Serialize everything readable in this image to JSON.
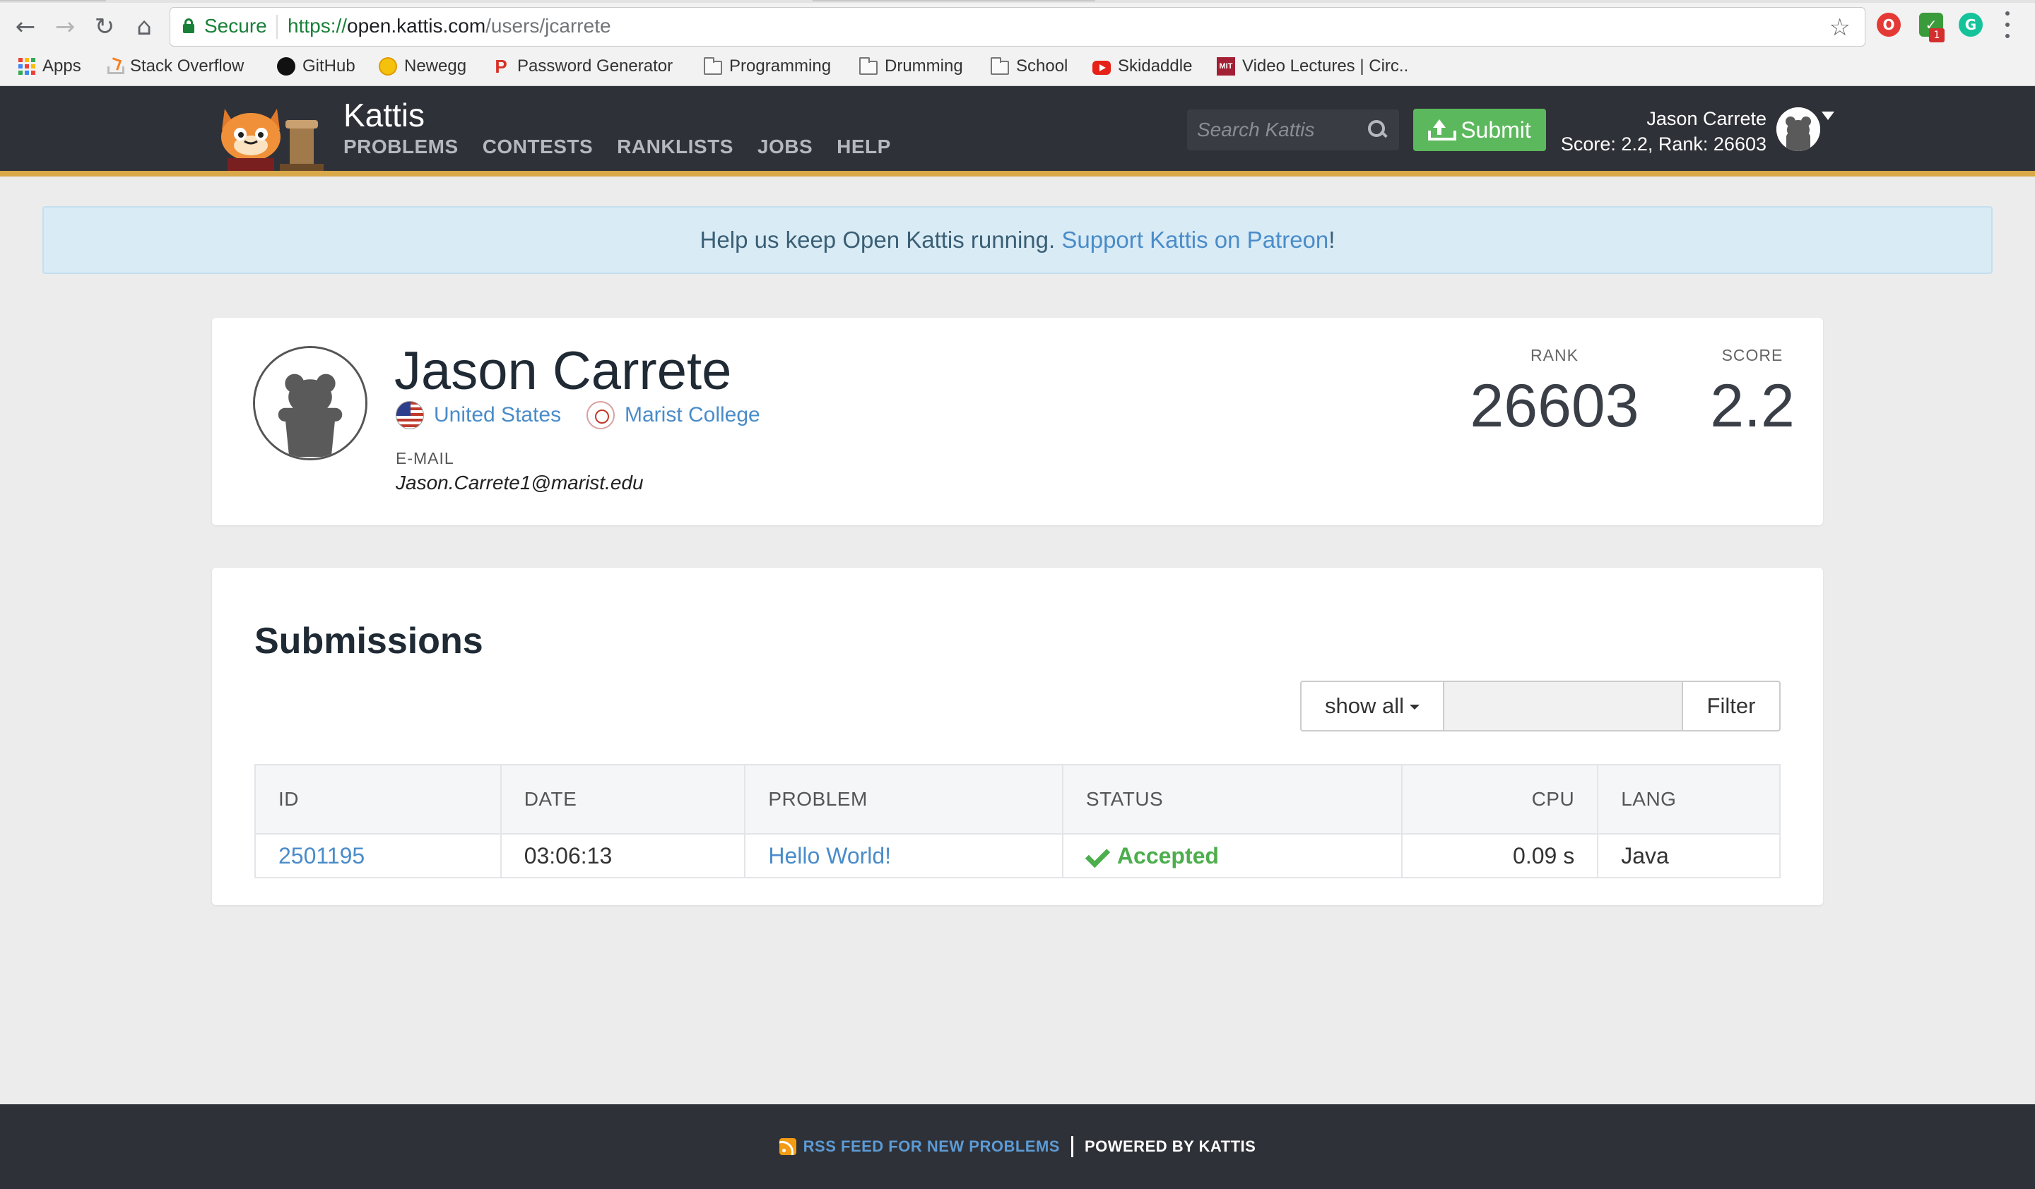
{
  "browser": {
    "secure_label": "Secure",
    "url_protocol": "https://",
    "url_host": "open.kattis.com",
    "url_path": "/users/jcarrete",
    "bookmarks": [
      {
        "label": "Apps",
        "icon": "apps-grid-icon"
      },
      {
        "label": "Stack Overflow",
        "icon": "stackoverflow-icon"
      },
      {
        "label": "GitHub",
        "icon": "github-icon"
      },
      {
        "label": "Newegg",
        "icon": "newegg-icon"
      },
      {
        "label": "Password Generator",
        "icon": "password-generator-icon"
      },
      {
        "label": "Programming",
        "icon": "folder-icon"
      },
      {
        "label": "Drumming",
        "icon": "folder-icon"
      },
      {
        "label": "School",
        "icon": "folder-icon"
      },
      {
        "label": "Skidaddle",
        "icon": "youtube-icon"
      },
      {
        "label": "Video Lectures | Circ..",
        "icon": "mit-ocw-icon"
      }
    ],
    "extension_badge": "1"
  },
  "header": {
    "brand": "Kattis",
    "nav": [
      "PROBLEMS",
      "CONTESTS",
      "RANKLISTS",
      "JOBS",
      "HELP"
    ],
    "search_placeholder": "Search Kattis",
    "submit_label": "Submit",
    "user_name": "Jason Carrete",
    "user_score_rank": "Score: 2.2, Rank: 26603"
  },
  "alert": {
    "text": "Help us keep Open Kattis running. ",
    "link": "Support Kattis on Patreon",
    "suffix": "!"
  },
  "profile": {
    "name": "Jason Carrete",
    "country": "United States",
    "school": "Marist College",
    "email_label": "E-MAIL",
    "email": "Jason.Carrete1@marist.edu",
    "rank_label": "RANK",
    "rank": "26603",
    "score_label": "SCORE",
    "score": "2.2"
  },
  "submissions": {
    "title": "Submissions",
    "filter_select": "show all",
    "filter_value": "",
    "filter_button": "Filter",
    "columns": [
      "ID",
      "DATE",
      "PROBLEM",
      "STATUS",
      "CPU",
      "LANG"
    ],
    "rows": [
      {
        "id": "2501195",
        "date": "03:06:13",
        "problem": "Hello World!",
        "status": "Accepted",
        "cpu": "0.09 s",
        "lang": "Java"
      }
    ]
  },
  "footer": {
    "rss": "RSS FEED FOR NEW PROBLEMS",
    "powered": "POWERED BY KATTIS"
  },
  "colors": {
    "header_bg": "#2f3138",
    "accent": "#d9a848",
    "link": "#4a8cc9",
    "success": "#5cb85c"
  }
}
